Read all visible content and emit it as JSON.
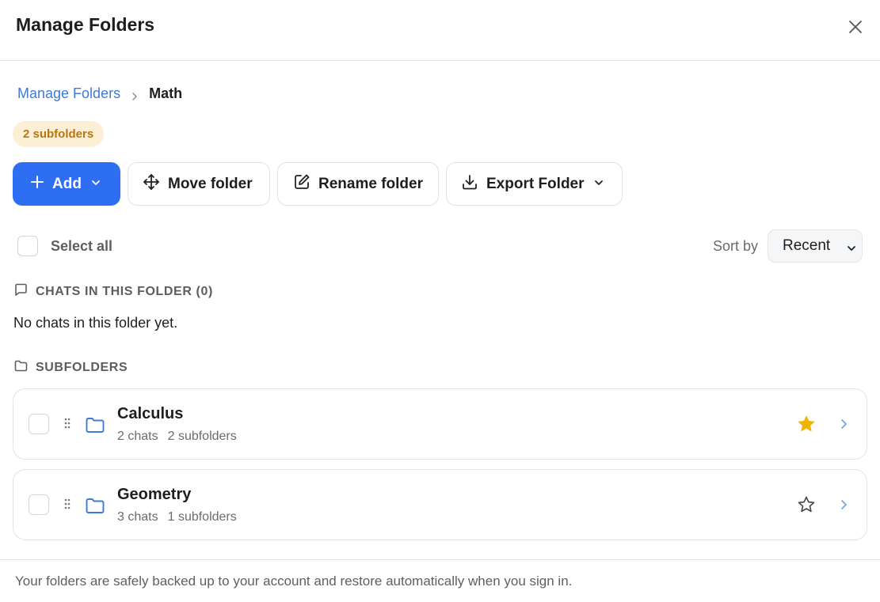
{
  "dialog": {
    "title": "Manage Folders",
    "close_icon": "close-icon"
  },
  "breadcrumb": {
    "root": "Manage Folders",
    "separator_icon": "chevron-right-icon",
    "current": "Math"
  },
  "badge": {
    "label": "2 subfolders",
    "bg_color": "#fcefd6",
    "text_color": "#b8760e"
  },
  "toolbar": {
    "add_label": "Add",
    "move_label": "Move folder",
    "rename_label": "Rename folder",
    "export_label": "Export Folder",
    "accent_color": "#2d6ef3"
  },
  "selection": {
    "select_all_label": "Select all",
    "select_all_checked": false
  },
  "sort": {
    "label": "Sort by",
    "selected": "Recent"
  },
  "chats_section": {
    "title": "CHATS IN THIS FOLDER (0)",
    "icon": "chat-bubble-icon",
    "empty_text": "No chats in this folder yet."
  },
  "subfolders_section": {
    "title": "SUBFOLDERS",
    "icon": "folder-icon",
    "items": [
      {
        "name": "Calculus",
        "chats": "2 chats",
        "subfolders": "2 subfolders",
        "starred": true
      },
      {
        "name": "Geometry",
        "chats": "3 chats",
        "subfolders": "1 subfolders",
        "starred": false
      }
    ]
  },
  "footer": {
    "note": "Your folders are safely backed up to your account and restore automatically when you sign in."
  },
  "colors": {
    "link": "#3f7bd0",
    "star_filled": "#f0b400",
    "folder_icon": "#3f7bd0"
  }
}
